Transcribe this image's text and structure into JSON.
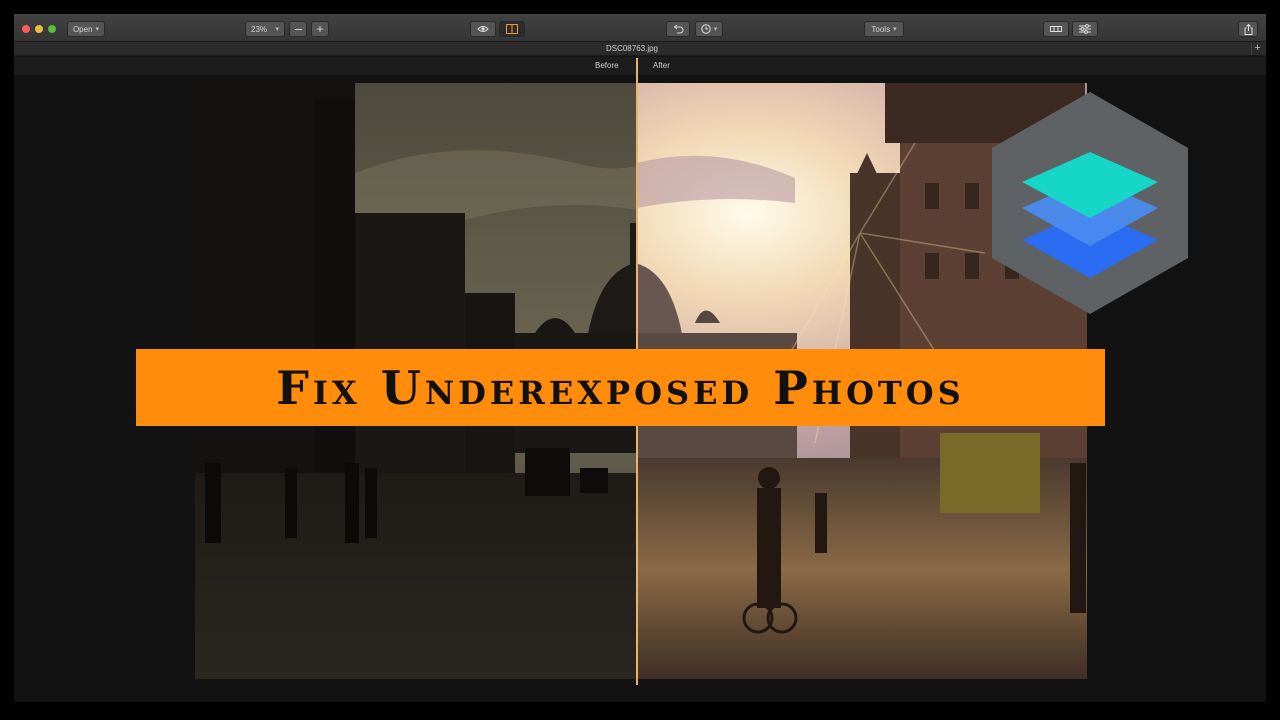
{
  "toolbar": {
    "open_label": "Open",
    "zoom_value": "23%",
    "tools_label": "Tools"
  },
  "tab": {
    "filename": "DSC08763.jpg"
  },
  "compare": {
    "before_label": "Before",
    "after_label": "After"
  },
  "overlay": {
    "title": "Fix Underexposed Photos",
    "banner_color": "#ff8c0a"
  },
  "colors": {
    "split_line": "#e7b270",
    "logo_hex": "#606366",
    "logo_top": "#16d6c8",
    "logo_mid": "#4a8bf0",
    "logo_bottom": "#2b6df2"
  },
  "icons": [
    "eye-icon",
    "compare-icon",
    "undo-icon",
    "history-icon",
    "filmstrip-icon",
    "sliders-icon",
    "share-icon",
    "plus-icon"
  ]
}
